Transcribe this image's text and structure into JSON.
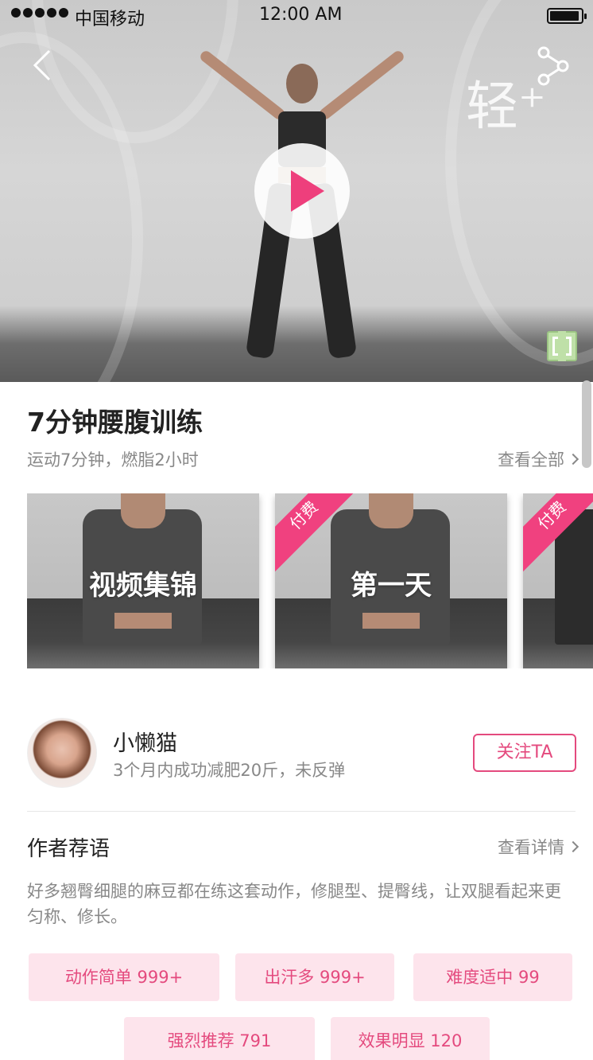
{
  "status_bar": {
    "carrier": "中国移动",
    "time": "12:00 AM"
  },
  "video": {
    "brand_mark": "轻⁺"
  },
  "course": {
    "title": "7分钟腰腹训练",
    "subtitle": "运动7分钟，燃脂2小时",
    "view_all": "查看全部"
  },
  "cards": [
    {
      "label": "视频集锦",
      "badge": ""
    },
    {
      "label": "第一天",
      "badge": "付费"
    },
    {
      "label": "",
      "badge": "付费"
    }
  ],
  "author": {
    "name": "小懒猫",
    "description": "3个月内成功减肥20斤，未反弹",
    "follow_label": "关注TA"
  },
  "recommendation": {
    "heading": "作者荐语",
    "more": "查看详情",
    "text": "好多翘臀细腿的麻豆都在练这套动作，修腿型、提臀线，让双腿看起来更匀称、修长。"
  },
  "tags": [
    {
      "text": "动作简单 999+"
    },
    {
      "text": "出汗多 999+"
    },
    {
      "text": "难度适中 99"
    },
    {
      "text": "强烈推荐 791"
    },
    {
      "text": "效果明显 120"
    }
  ],
  "colors": {
    "accent": "#e44a7e",
    "tag_bg": "#fde4ec",
    "badge": "#f0417f"
  }
}
